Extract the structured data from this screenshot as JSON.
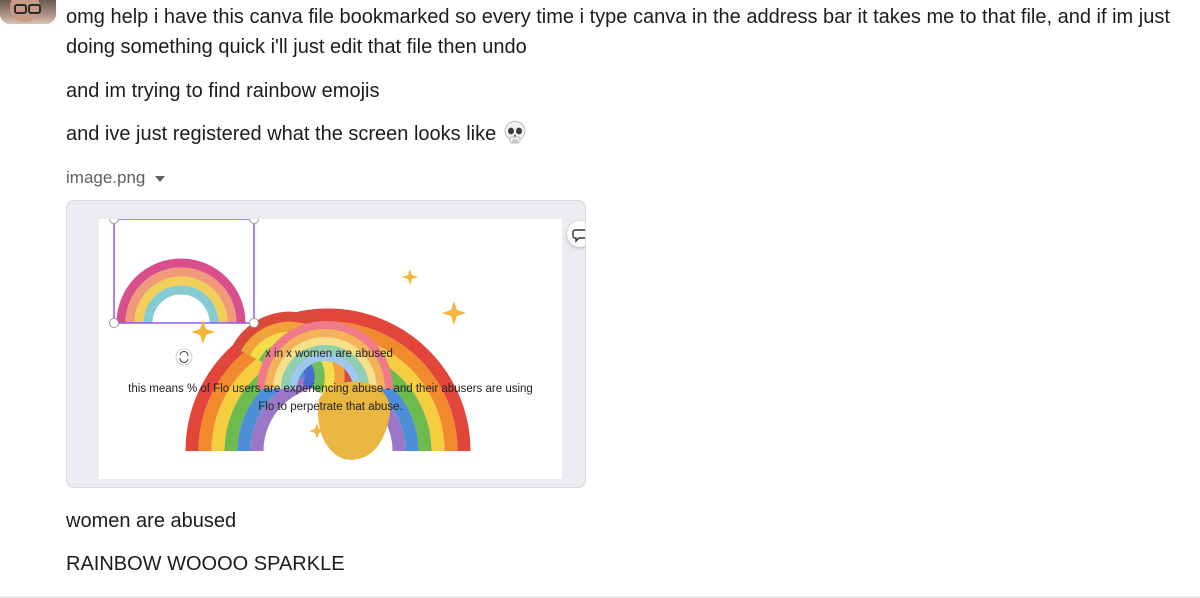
{
  "messages": [
    {
      "text": "omg help i have this canva file bookmarked so every time i type canva in the address bar it takes me to that file, and if im just doing something quick i'll just edit that file then undo"
    },
    {
      "text": "and im trying to find rainbow emojis"
    },
    {
      "text": "and ive just registered what the screen looks like",
      "emoji": "skull-emoji"
    },
    {
      "text": "women are abused"
    },
    {
      "text": "RAINBOW WOOOO SPARKLE"
    }
  ],
  "attachment": {
    "filename": "image.png",
    "canvas_text_1": "x in x women are abused",
    "canvas_text_2a": "this means % of Flo users are experiencing abuse - and their abusers are using",
    "canvas_text_2b": "Flo to perpetrate that abuse.",
    "icons": [
      "chevron-down-icon",
      "comment-icon",
      "rotate-icon"
    ]
  }
}
